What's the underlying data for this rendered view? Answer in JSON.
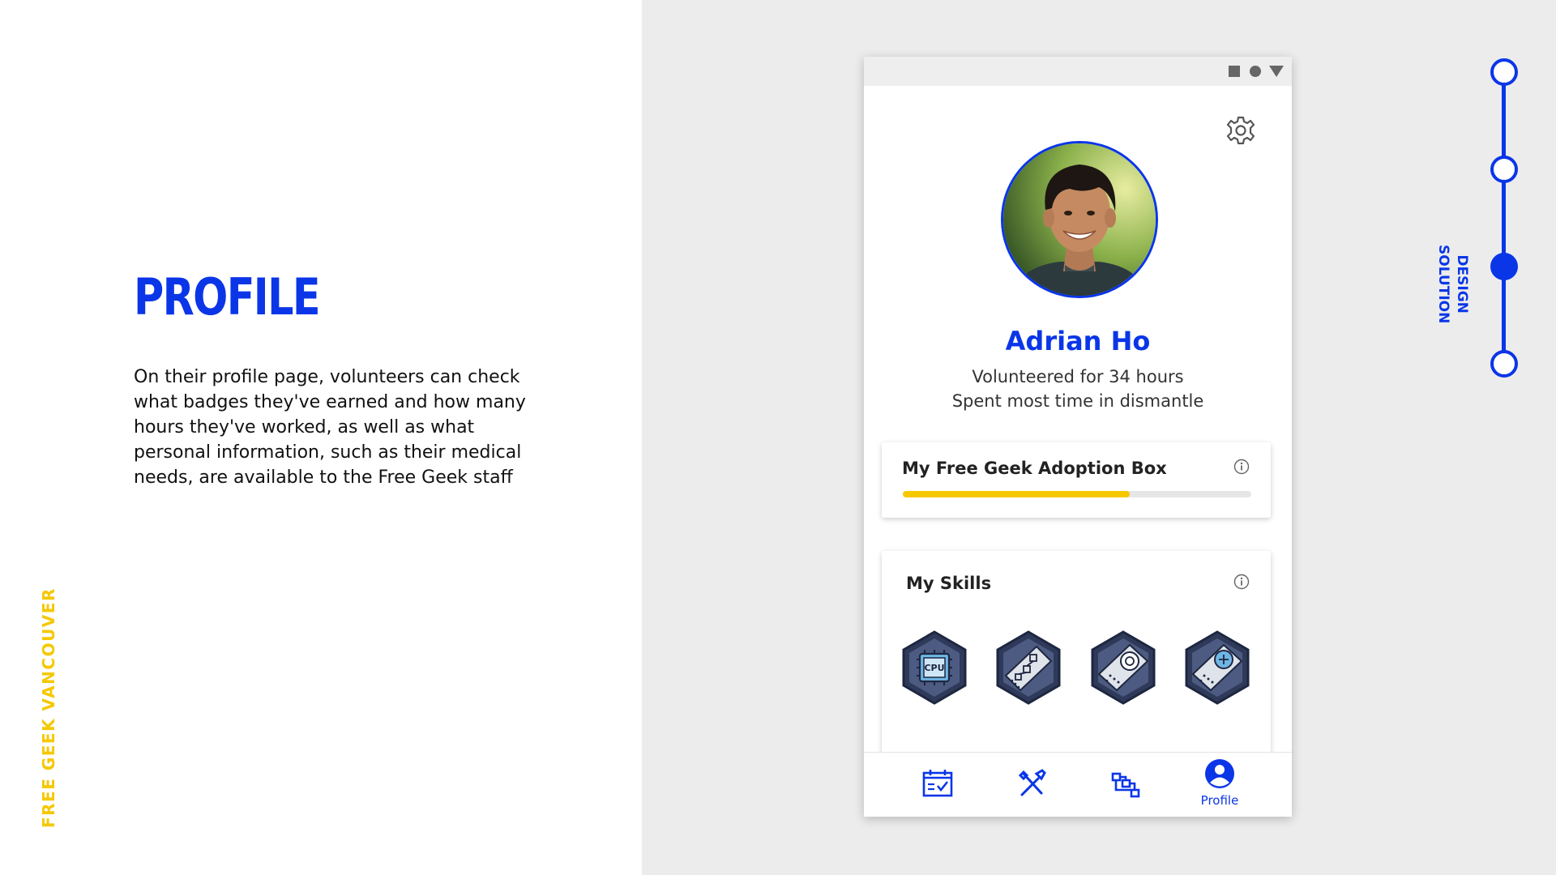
{
  "slide": {
    "title": "PROFILE",
    "description": "On their profile page, volunteers can check what badges they've earned and how many hours they've worked, as well as what personal information, such as their medical needs, are available to the Free Geek staff",
    "brand": "FREE GEEK VANCOUVER"
  },
  "timeline": {
    "label_line1": "DESIGN",
    "label_line2": "SOLUTION",
    "active_step": 3,
    "total_steps": 4
  },
  "profile": {
    "name": "Adrian Ho",
    "volunteer_hours": "Volunteered for 34 hours",
    "most_time": "Spent most time in dismantle"
  },
  "adoption_box": {
    "title": "My Free Geek Adoption Box",
    "progress_fraction": 0.65
  },
  "skills": {
    "title": "My Skills",
    "badges": [
      {
        "icon": "cpu-badge-icon",
        "text": "CPU"
      },
      {
        "icon": "circuit-board-badge-icon"
      },
      {
        "icon": "expansion-card-badge-icon"
      },
      {
        "icon": "graphics-card-badge-icon"
      }
    ]
  },
  "nav": {
    "items": [
      {
        "icon": "calendar-icon"
      },
      {
        "icon": "tools-icon"
      },
      {
        "icon": "sitemap-icon"
      },
      {
        "icon": "profile-icon",
        "label": "Profile",
        "active": true
      }
    ]
  },
  "colors": {
    "brand_blue": "#0a36e8",
    "brand_yellow": "#f5c800",
    "badge_dark": "#2f3a5a",
    "badge_mid": "#4d5b82"
  }
}
